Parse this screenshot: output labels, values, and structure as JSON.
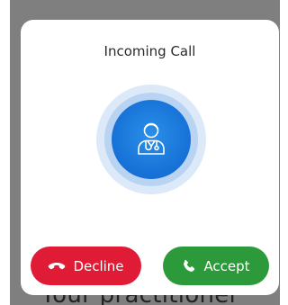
{
  "dialog": {
    "title": "Incoming Call",
    "avatar_icon": "doctor-icon",
    "decline_label": "Decline",
    "decline_icon": "phone-hangup-icon",
    "accept_label": "Accept",
    "accept_icon": "phone-icon",
    "decline_color": "#e01b36",
    "accept_color": "#2c9a3a",
    "accent_color": "#1670d6"
  },
  "background": {
    "partial_text": "Your practitioner"
  }
}
